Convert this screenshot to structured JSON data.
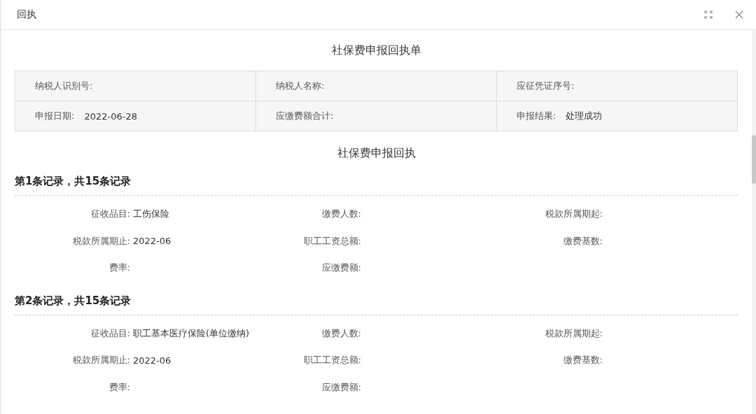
{
  "dialog": {
    "title": "回执",
    "receipt_title": "社保费申报回执单",
    "summary": [
      [
        {
          "label": "纳税人识别号:"
        },
        {
          "label": "纳税人名称:"
        },
        {
          "label": "应征凭证序号:"
        }
      ],
      [
        {
          "label": "申报日期:",
          "value": "2022-06-28"
        },
        {
          "label": "应缴费额合计:"
        },
        {
          "label": "申报结果:",
          "value": "处理成功"
        }
      ]
    ],
    "section_title": "社保费申报回执",
    "records": [
      {
        "heading": "第1条记录，共15条记录",
        "fields": [
          {
            "label": "征收品目:",
            "value": "工伤保险"
          },
          {
            "label": "缴费人数:"
          },
          {
            "label": "税款所属期起:"
          },
          {
            "label": "税款所属期止:",
            "value": "2022-06"
          },
          {
            "label": "职工工资总额:"
          },
          {
            "label": "缴费基数:"
          },
          {
            "label": "费率:"
          },
          {
            "label": "应缴费额:"
          }
        ]
      },
      {
        "heading": "第2条记录，共15条记录",
        "fields": [
          {
            "label": "征收品目:",
            "value": "职工基本医疗保险(单位缴纳)"
          },
          {
            "label": "缴费人数:"
          },
          {
            "label": "税款所属期起:"
          },
          {
            "label": "税款所属期止:",
            "value": "2022-06"
          },
          {
            "label": "职工工资总额:"
          },
          {
            "label": "缴费基数:"
          },
          {
            "label": "费率:"
          },
          {
            "label": "应缴费额:"
          }
        ]
      }
    ]
  }
}
